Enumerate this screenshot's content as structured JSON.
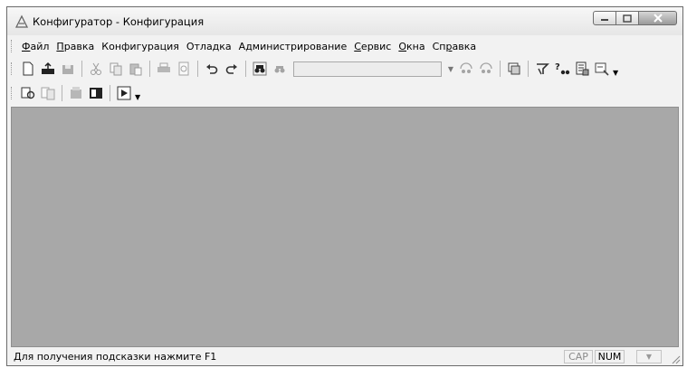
{
  "window": {
    "title": "Конфигуратор - Конфигурация"
  },
  "menu": [
    {
      "pre": "",
      "ul": "Ф",
      "post": "айл"
    },
    {
      "pre": "",
      "ul": "П",
      "post": "равка"
    },
    {
      "pre": "",
      "ul": "",
      "post": "Конфигурация"
    },
    {
      "pre": "",
      "ul": "",
      "post": "Отладка"
    },
    {
      "pre": "",
      "ul": "",
      "post": "Администрирование"
    },
    {
      "pre": "",
      "ul": "С",
      "post": "ервис"
    },
    {
      "pre": "",
      "ul": "О",
      "post": "кна"
    },
    {
      "pre": "Сп",
      "ul": "р",
      "post": "авка"
    }
  ],
  "toolbar": {
    "search_value": "",
    "icons": [
      "new-document-icon",
      "open-icon",
      "save-icon",
      "cut-icon",
      "copy-icon",
      "paste-icon",
      "print-icon",
      "print-preview-icon",
      "undo-icon",
      "redo-icon",
      "find-icon",
      "find-next-icon",
      "find-combo",
      "find-prev-icon",
      "find-next-match-icon",
      "window-list-icon",
      "syntax-helper-icon",
      "search-help-icon",
      "reference-icon",
      "version-icon"
    ]
  },
  "toolbar2": {
    "icons": [
      "update-db-icon",
      "compare-icon",
      "config-support-icon",
      "config-table-icon",
      "debug-start-icon"
    ]
  },
  "status": {
    "hint": "Для получения подсказки нажмите F1",
    "cap": "CAP",
    "num": "NUM"
  },
  "colors": {
    "client_bg": "#a8a8a8",
    "chrome": "#f2f2f2"
  }
}
